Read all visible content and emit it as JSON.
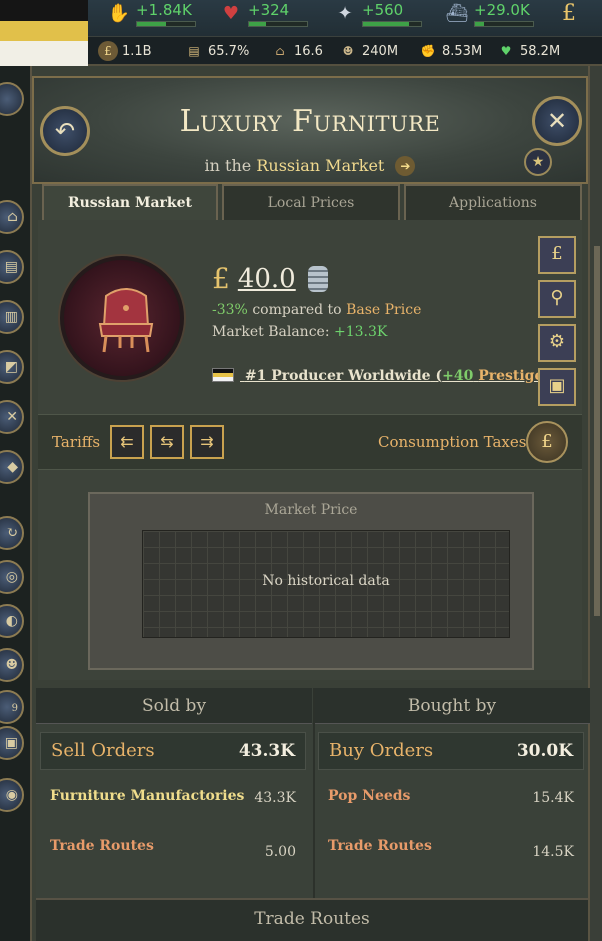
{
  "topbar": {
    "resources": [
      {
        "icon": "coin-bag-icon",
        "value": "+1.84K",
        "fill": 0.5
      },
      {
        "icon": "heart-icon",
        "value": "+324",
        "fill": 0.3
      },
      {
        "icon": "dove-icon",
        "value": "+560",
        "fill": 0.8
      },
      {
        "icon": "ship-icon",
        "value": "+29.0K",
        "fill": 0.15
      }
    ],
    "stats": [
      {
        "icon": "pound-icon",
        "value": "1.1B"
      },
      {
        "icon": "book-icon",
        "value": "65.7%"
      },
      {
        "icon": "hat-icon",
        "value": "16.6"
      },
      {
        "icon": "people-icon",
        "value": "240M"
      },
      {
        "icon": "fist-icon",
        "value": "8.53M"
      },
      {
        "icon": "heart-green-icon",
        "value": "58.2M"
      }
    ],
    "pound_symbol": "£"
  },
  "leftbar": {
    "badge": "9"
  },
  "header": {
    "title": "Luxury Furniture",
    "subtitle_prefix": "in the",
    "market_name": "Russian Market",
    "back_icon": "back-arrow-icon",
    "close_icon": "close-icon",
    "star_icon": "star-icon"
  },
  "tabs": [
    {
      "label": "Russian Market",
      "active": true
    },
    {
      "label": "Local Prices",
      "active": false
    },
    {
      "label": "Applications",
      "active": false
    }
  ],
  "summary": {
    "currency": "£",
    "price": "40.0",
    "change": "-33%",
    "compared_text": "compared to",
    "base_price": "Base Price",
    "balance_label": "Market Balance:",
    "balance_value": "+13.3K",
    "producer_text": "#1 Producer Worldwide",
    "prestige_open": "(",
    "prestige_value": "+40",
    "prestige_label": "Prestige",
    "prestige_close": ")"
  },
  "side_buttons": [
    "pound-icon",
    "magnifier-icon",
    "gear-icon",
    "crate-icon"
  ],
  "tariffs": {
    "label": "Tariffs",
    "buttons": [
      "import-icon",
      "trade-both-icon",
      "export-icon"
    ],
    "consumption_label": "Consumption Taxes",
    "consumption_icon": "tax-bag-icon"
  },
  "chart": {
    "title": "Market Price",
    "empty_text": "No historical data"
  },
  "sold_by": {
    "header": "Sold by",
    "total_label": "Sell Orders",
    "total_value": "43.3K",
    "rows": [
      {
        "label": "Furniture Manufactories",
        "value": "43.3K"
      },
      {
        "label": "Trade Routes",
        "value": "5.00"
      }
    ]
  },
  "bought_by": {
    "header": "Bought by",
    "total_label": "Buy Orders",
    "total_value": "30.0K",
    "rows": [
      {
        "label": "Pop Needs",
        "value": "15.4K"
      },
      {
        "label": "Trade Routes",
        "value": "14.5K"
      }
    ]
  },
  "footer": {
    "label": "Trade Routes"
  }
}
